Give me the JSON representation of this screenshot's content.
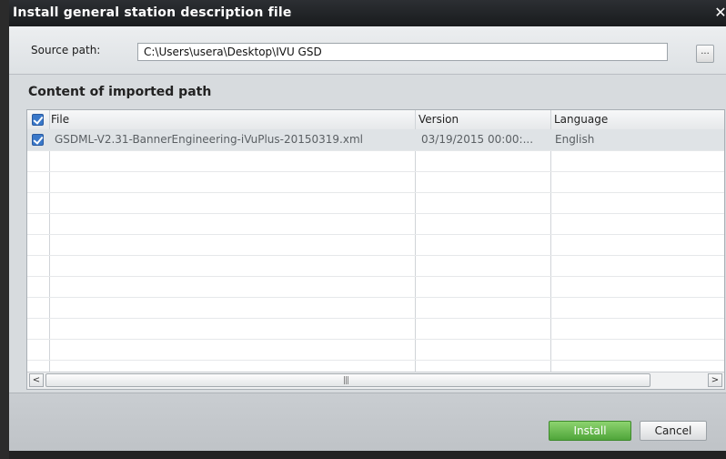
{
  "window": {
    "title": "Install general station description file",
    "close_glyph": "✕"
  },
  "source": {
    "label": "Source path:",
    "value": "C:\\Users\\usera\\Desktop\\IVU GSD",
    "browse_label": "..."
  },
  "content": {
    "title": "Content of imported path",
    "columns": {
      "file": "File",
      "version": "Version",
      "language": "Language"
    },
    "select_all_checked": true,
    "rows": [
      {
        "checked": true,
        "file": "GSDML-V2.31-BannerEngineering-iVuPlus-20150319.xml",
        "version": "03/19/2015 00:00:...",
        "language": "English"
      }
    ]
  },
  "scrollbar": {
    "left_glyph": "<",
    "right_glyph": ">",
    "grip_glyph": "|||"
  },
  "buttons": {
    "install": "Install",
    "cancel": "Cancel"
  },
  "colors": {
    "install_green": "#5db548",
    "titlebar": "#1f2124",
    "selected_row": "#dfe3e6"
  }
}
